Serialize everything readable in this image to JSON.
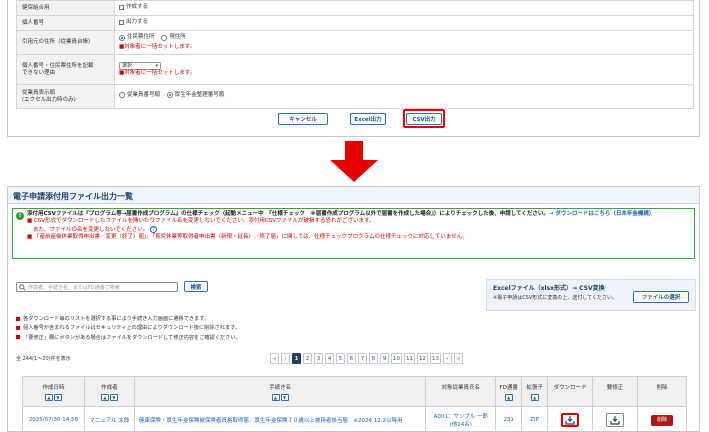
{
  "top_form": {
    "rows": [
      {
        "label": "健保組合用",
        "option": "作成する"
      },
      {
        "label": "個人番号",
        "option": "出力する"
      }
    ],
    "address_row": {
      "label": "引用元の住所（従業員台帳）",
      "options": [
        "住民票住所",
        "現住所"
      ],
      "note": "対象者に一括セットします。"
    },
    "reason_row": {
      "label_line1": "個人番号・住民票住所を記載",
      "label_line2": "できない理由",
      "select_value": "選択",
      "note": "対象者に一括セットします。"
    },
    "display_row": {
      "label_line1": "従業員表示順",
      "label_line2": "(エクセル出力時のみ)",
      "options": [
        "従業員番号順",
        "厚生年金整理番号順"
      ]
    },
    "buttons": {
      "cancel": "キャンセル",
      "excel": "Excel出力",
      "csv": "CSV出力"
    }
  },
  "bottom": {
    "title": "電子申請添付用ファイル出力一覧",
    "notice": {
      "line1": "添付用CSVファイルは『プログラム等→届書作成プログラム』の仕様チェック（起動メニュー中　『仕様チェック　※届書作成プログラム以外で届書を作成した場合』）によりチェックした後、申請してください。",
      "link": "→ ダウンロードはこちら（日本年金機構）",
      "red1": "CSV形式でダウンロードしたファイルを開いたりファイル名を変更しないでください。添付用CSVファイルが破損する恐れがございます。",
      "red2": "また、ファイルの名を変更しないでください。",
      "help": "?",
      "red3": "「産前産後休業取得申出書／変更（終了）届」、「育児休業等取得者申出書（新規・延長）／終了届」に関しては、仕様チェックプログラムの仕様チェックに対応していません。"
    },
    "search": {
      "placeholder": "作成者、手続き名、またはFD通番で検索",
      "button": "検索"
    },
    "excel_box": {
      "title": "Excelファイル（xlsx形式）→ CSV変換",
      "sub": "※電子申請はCSV形式に変換の上、送付してください。",
      "button": "ファイルの選択"
    },
    "bullets": [
      "各ダウンロード毎のリストを選択する事により手続き入力画面に遷移できます。",
      "個人番号が含まれるファイルはセキュリティ上の理由によりダウンロード後に削除されます。",
      "『要修正』欄にボタンがある場合はファイルをダウンロードして修正内容をご確認ください。"
    ],
    "count": "全 244(1〜20)件を表示",
    "pager": {
      "first": "«",
      "prev": "‹",
      "pages": [
        "1",
        "2",
        "3",
        "4",
        "5",
        "6",
        "7",
        "8",
        "9",
        "10",
        "11",
        "12",
        "13"
      ],
      "next": "›",
      "last": "»",
      "active": "1"
    },
    "table": {
      "headers": [
        "作成日時",
        "作成者",
        "手続き名",
        "対象従業員氏名",
        "FD通番",
        "拡張子",
        "ダウンロード",
        "要修正",
        "削除"
      ],
      "sort_up": "▲",
      "sort_down": "▼",
      "row": {
        "date": "2025/07/30 14:58",
        "creator": "マニュアル 太郎",
        "procedure": "健康保険・厚生年金保険被保険者資格取得届／厚生年金保険７０歳以上被用者該当届　※2024.12.2以降用",
        "employee_line1": "A001：サンプル 一郎",
        "employee_line2": "(他14名)",
        "fd": "231",
        "ext": "ZIP",
        "delete": "削除"
      }
    }
  },
  "colors": {
    "accent_red": "#e60000",
    "brand_blue": "#1e3f6b",
    "link_blue": "#1d5fbf",
    "notice_green": "#3da53d"
  }
}
